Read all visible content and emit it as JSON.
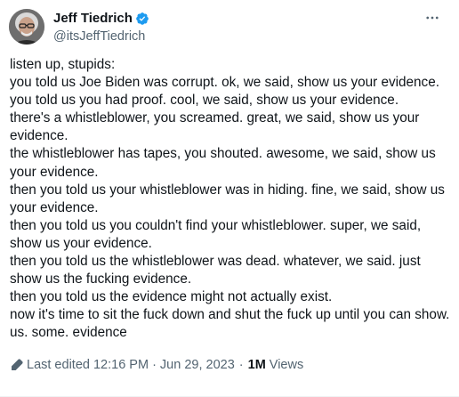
{
  "author": {
    "display_name": "Jeff Tiedrich",
    "handle": "@itsJeffTiedrich",
    "verified": true
  },
  "menu_icon": "more-horizontal-icon",
  "tweet_text": "listen up, stupids:\nyou told us Joe Biden was corrupt. ok, we said, show us your evidence.\nyou told us you had proof. cool, we said, show us your evidence.\nthere's a whistleblower, you screamed. great, we said, show us your evidence.\nthe whistleblower has tapes, you shouted. awesome, we said, show us your evidence.\nthen you told us your whistleblower was in hiding. fine, we said, show us your evidence.\nthen you told us you couldn't find your whistleblower. super, we said, show us your evidence.\nthen you told us the whistleblower was dead. whatever, we said. just show us the fucking evidence.\nthen you told us the evidence might not actually exist.\nnow it's time to sit the fuck down and shut the fuck up until you can show. us. some. evidence",
  "footer": {
    "edited_label": "Last edited 12:16 PM · Jun 29, 2023",
    "separator": "·",
    "views_count": "1M",
    "views_label": "Views"
  },
  "colors": {
    "text_primary": "#0f1419",
    "text_secondary": "#536471",
    "verified_blue": "#1d9bf0"
  }
}
